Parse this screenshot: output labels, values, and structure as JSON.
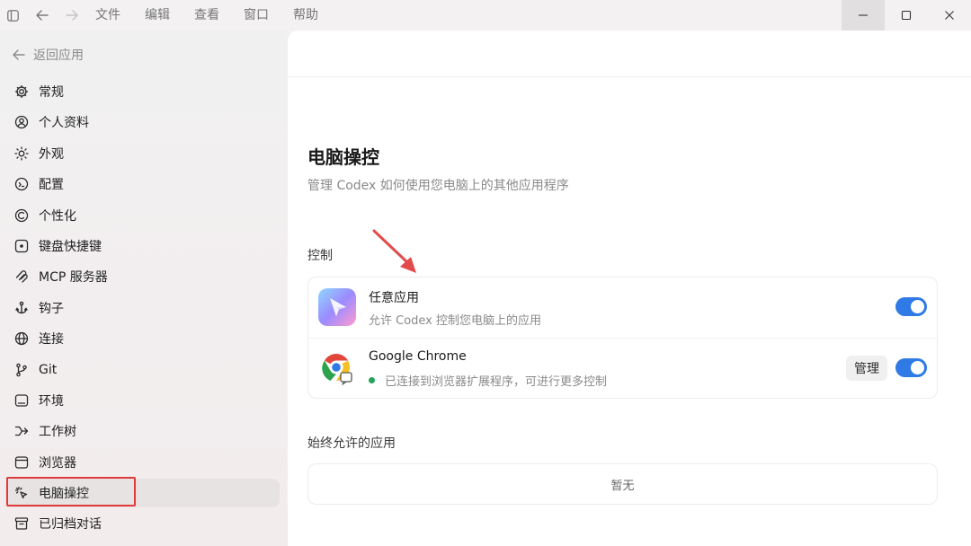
{
  "titlebar": {
    "menu": [
      "文件",
      "编辑",
      "查看",
      "窗口",
      "帮助"
    ]
  },
  "sidebar": {
    "back_label": "返回应用",
    "items": [
      {
        "label": "常规",
        "icon": "gear-icon"
      },
      {
        "label": "个人资料",
        "icon": "user-icon"
      },
      {
        "label": "外观",
        "icon": "sun-icon"
      },
      {
        "label": "配置",
        "icon": "config-icon"
      },
      {
        "label": "个性化",
        "icon": "personalize-icon"
      },
      {
        "label": "键盘快捷键",
        "icon": "keyboard-icon"
      },
      {
        "label": "MCP 服务器",
        "icon": "mcp-icon"
      },
      {
        "label": "钩子",
        "icon": "hook-icon"
      },
      {
        "label": "连接",
        "icon": "globe-icon"
      },
      {
        "label": "Git",
        "icon": "git-branch-icon"
      },
      {
        "label": "环境",
        "icon": "environment-icon"
      },
      {
        "label": "工作树",
        "icon": "worktree-icon"
      },
      {
        "label": "浏览器",
        "icon": "browser-icon"
      },
      {
        "label": "电脑操控",
        "icon": "cursor-click-icon",
        "active": true
      },
      {
        "label": "已归档对话",
        "icon": "archive-icon"
      }
    ]
  },
  "main": {
    "title": "电脑操控",
    "subtitle": "管理 Codex 如何使用您电脑上的其他应用程序",
    "control_section": {
      "label": "控制",
      "rows": [
        {
          "name": "任意应用",
          "description": "允许 Codex 控制您电脑上的应用",
          "enabled": true,
          "icon": "any-app-icon"
        },
        {
          "name": "Google Chrome",
          "description": "已连接到浏览器扩展程序，可进行更多控制",
          "manage_label": "管理",
          "enabled": true,
          "status_color": "#22a45a",
          "icon": "chrome-icon"
        }
      ]
    },
    "allowed_section": {
      "label": "始终允许的应用",
      "empty_text": "暂无"
    }
  },
  "colors": {
    "accent": "#2f7ae5",
    "highlight": "#e03a3a",
    "arrow": "#e34b4b"
  }
}
